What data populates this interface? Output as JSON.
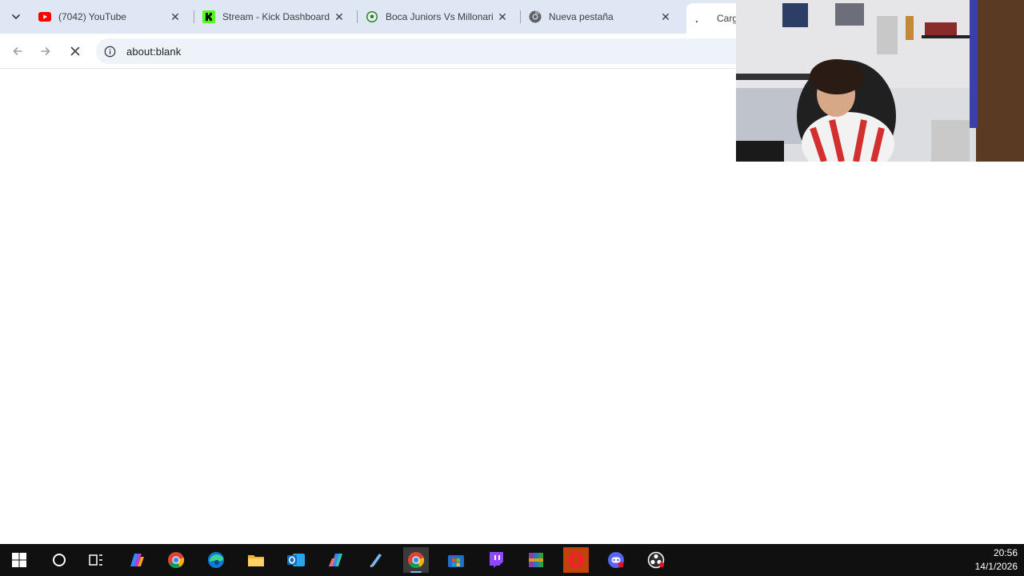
{
  "tabs": [
    {
      "title": "(7042) YouTube",
      "icon": "youtube-icon"
    },
    {
      "title": "Stream - Kick Dashboard",
      "icon": "kick-icon"
    },
    {
      "title": "Boca Juniors Vs Millonari",
      "icon": "soccer-ball-icon"
    },
    {
      "title": "Nueva pestaña",
      "icon": "chrome-icon"
    }
  ],
  "active_tab": {
    "title": "Carga",
    "icon": "loading-spinner-icon"
  },
  "toolbar": {
    "back_icon": "back-arrow-icon",
    "forward_icon": "forward-arrow-icon",
    "stop_icon": "stop-loading-icon",
    "site_info_icon": "info-icon",
    "url": "about:blank"
  },
  "webcam": {
    "description_icon": "webcam-overlay"
  },
  "taskbar": {
    "items": [
      "start-icon",
      "search-icon",
      "task-view-icon",
      "copilot-icon",
      "chrome-icon",
      "edge-icon",
      "file-explorer-icon",
      "outlook-icon",
      "m365-copilot-icon",
      "app-icon",
      "chrome-active-icon",
      "microsoft-store-icon",
      "twitch-icon",
      "winrar-icon",
      "opera-icon",
      "discord-icon",
      "obs-icon"
    ],
    "time": "20:56",
    "date": "14/1/2026"
  },
  "colors": {
    "tabstrip_bg": "#dfe7f4",
    "omnibox_bg": "#eef2f9",
    "taskbar_bg": "#101010",
    "youtube_red": "#ff0000",
    "kick_green": "#53fc18",
    "twitch_purple": "#9146ff"
  }
}
